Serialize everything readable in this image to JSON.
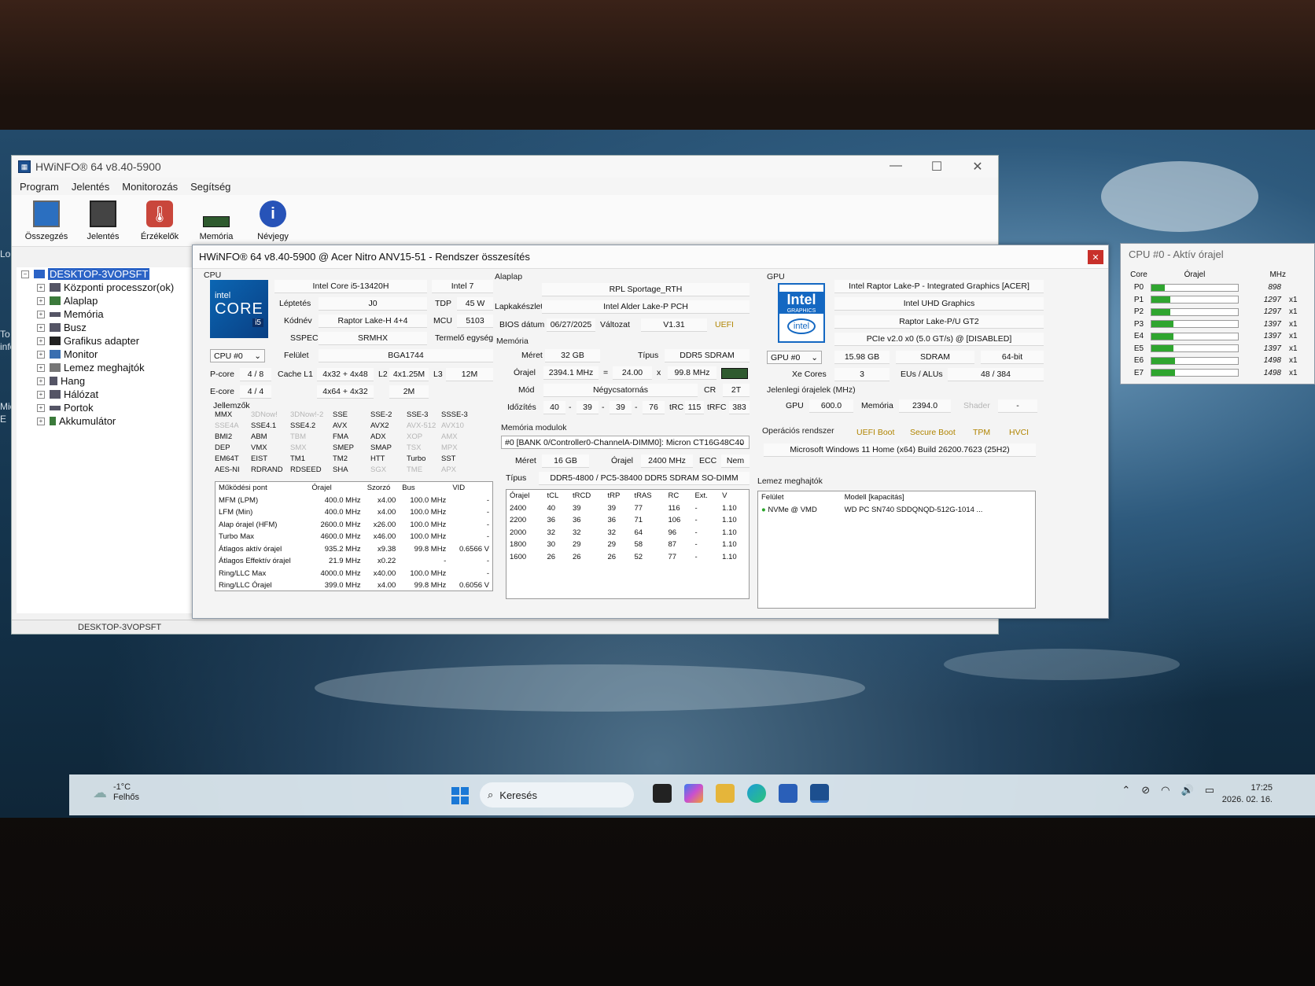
{
  "main_window": {
    "title": "HWiNFO® 64 v8.40-5900",
    "menu": [
      "Program",
      "Jelentés",
      "Monitorozás",
      "Segítség"
    ],
    "toolbar": [
      {
        "label": "Összegzés",
        "icon": "monitor-icon"
      },
      {
        "label": "Jelentés",
        "icon": "floppy-disk-icon"
      },
      {
        "label": "Érzékelők",
        "icon": "thermometer-icon"
      },
      {
        "label": "Memória",
        "icon": "ram-module-icon"
      },
      {
        "label": "Névjegy",
        "icon": "info-icon"
      }
    ],
    "tree": [
      {
        "label": "DESKTOP-3VOPSFT",
        "depth": 0,
        "selected": true
      },
      {
        "label": "Központi processzor(ok)",
        "depth": 1
      },
      {
        "label": "Alaplap",
        "depth": 1
      },
      {
        "label": "Memória",
        "depth": 1
      },
      {
        "label": "Busz",
        "depth": 1
      },
      {
        "label": "Grafikus adapter",
        "depth": 1
      },
      {
        "label": "Monitor",
        "depth": 1
      },
      {
        "label": "Lemez meghajtók",
        "depth": 1
      },
      {
        "label": "Hang",
        "depth": 1
      },
      {
        "label": "Hálózat",
        "depth": 1
      },
      {
        "label": "Portok",
        "depth": 1
      },
      {
        "label": "Akkumulátor",
        "depth": 1
      }
    ],
    "status": "DESKTOP-3VOPSFT"
  },
  "summary": {
    "title": "HWiNFO® 64 v8.40-5900 @ Acer Nitro ANV15-51 - Rendszer összesítés",
    "cpu": {
      "group": "CPU",
      "logo_top": "intel",
      "logo_mid": "CORE",
      "logo_badge": "i5",
      "name": "Intel Core i5-13420H",
      "brand": "Intel 7",
      "step_label": "Léptetés",
      "step": "J0",
      "tdp_label": "TDP",
      "tdp": "45 W",
      "code_label": "Kódnév",
      "code": "Raptor Lake-H 4+4",
      "mcu_label": "MCU",
      "mcu": "5103",
      "sspec_label": "SSPEC",
      "sspec": "SRMHX",
      "prod": "Termelő egység",
      "select": "CPU #0",
      "surface_label": "Felület",
      "surface": "BGA1744",
      "pcore_label": "P-core",
      "pcore": "4 / 8",
      "cache_label": "Cache L1",
      "l1p": "4x32 + 4x48",
      "l2_label": "L2",
      "l2p": "4x1.25M",
      "l3_label": "L3",
      "l3": "12M",
      "ecore_label": "E-core",
      "ecore": "4 / 4",
      "l1e": "4x64 + 4x32",
      "l2e": "2M",
      "features_label": "Jellemzők",
      "features": [
        [
          "MMX",
          "3DNow!",
          "3DNow!-2",
          "SSE",
          "SSE-2",
          "SSE-3",
          "SSSE-3"
        ],
        [
          "SSE4A",
          "SSE4.1",
          "SSE4.2",
          "AVX",
          "AVX2",
          "AVX-512",
          "AVX10"
        ],
        [
          "BMI2",
          "ABM",
          "TBM",
          "FMA",
          "ADX",
          "XOP",
          "AMX"
        ],
        [
          "DEP",
          "VMX",
          "SMX",
          "SMEP",
          "SMAP",
          "TSX",
          "MPX"
        ],
        [
          "EM64T",
          "EIST",
          "TM1",
          "TM2",
          "HTT",
          "Turbo",
          "SST"
        ],
        [
          "AES-NI",
          "RDRAND",
          "RDSEED",
          "SHA",
          "SGX",
          "TME",
          "APX"
        ]
      ],
      "features_dim": [
        [
          false,
          true,
          true,
          false,
          false,
          false,
          false
        ],
        [
          true,
          false,
          false,
          false,
          false,
          true,
          true
        ],
        [
          false,
          false,
          true,
          false,
          false,
          true,
          true
        ],
        [
          false,
          false,
          true,
          false,
          false,
          true,
          true
        ],
        [
          false,
          false,
          false,
          false,
          false,
          false,
          false
        ],
        [
          false,
          false,
          false,
          false,
          true,
          true,
          true
        ]
      ],
      "op_headers": [
        "Működési pont",
        "Órajel",
        "Szorzó",
        "Bus",
        "VID"
      ],
      "op_rows": [
        [
          "MFM (LPM)",
          "400.0 MHz",
          "x4.00",
          "100.0 MHz",
          "-"
        ],
        [
          "LFM (Min)",
          "400.0 MHz",
          "x4.00",
          "100.0 MHz",
          "-"
        ],
        [
          "Alap órajel (HFM)",
          "2600.0 MHz",
          "x26.00",
          "100.0 MHz",
          "-"
        ],
        [
          "Turbo Max",
          "4600.0 MHz",
          "x46.00",
          "100.0 MHz",
          "-"
        ],
        [
          "Átlagos aktív órajel",
          "935.2 MHz",
          "x9.38",
          "99.8 MHz",
          "0.6566 V"
        ],
        [
          "Átlagos Effektív órajel",
          "21.9 MHz",
          "x0.22",
          "-",
          "-"
        ],
        [
          "Ring/LLC Max",
          "4000.0 MHz",
          "x40.00",
          "100.0 MHz",
          "-"
        ],
        [
          "Ring/LLC Órajel",
          "399.0 MHz",
          "x4.00",
          "99.8 MHz",
          "0.6056 V"
        ]
      ]
    },
    "board": {
      "group": "Alaplap",
      "name": "RPL Sportage_RTH",
      "chipset_label": "Lapkakészlet",
      "chipset": "Intel Alder Lake-P PCH",
      "bios_label": "BIOS dátum",
      "bios_date": "06/27/2025",
      "ver_label": "Változat",
      "ver": "V1.31",
      "uefi": "UEFI"
    },
    "memory": {
      "group": "Memória",
      "size_label": "Méret",
      "size": "32 GB",
      "type_label": "Típus",
      "type": "DDR5 SDRAM",
      "clock_label": "Órajel",
      "clock": "2394.1 MHz",
      "eq": "=",
      "mult": "24.00",
      "x": "x",
      "bus": "99.8 MHz",
      "mode_label": "Mód",
      "mode": "Négycsatornás",
      "cr_label": "CR",
      "cr": "2T",
      "timing_label": "Időzítés",
      "timings": [
        "40",
        "39",
        "39",
        "76"
      ],
      "trc_label": "tRC",
      "trc": "115",
      "trfc_label": "tRFC",
      "trfc": "383",
      "modules_label": "Memória modulok",
      "module_select": "#0 [BANK 0/Controller0-ChannelA-DIMM0]: Micron CT16G48C40",
      "m_size_label": "Méret",
      "m_size": "16 GB",
      "m_clock_label": "Órajel",
      "m_clock": "2400 MHz",
      "ecc_label": "ECC",
      "ecc": "Nem",
      "m_type_label": "Típus",
      "m_type": "DDR5-4800 / PC5-38400 DDR5 SDRAM SO-DIMM",
      "t_headers": [
        "Órajel",
        "tCL",
        "tRCD",
        "tRP",
        "tRAS",
        "RC",
        "Ext.",
        "V"
      ],
      "t_rows": [
        [
          "2400",
          "40",
          "39",
          "39",
          "77",
          "116",
          "-",
          "1.10"
        ],
        [
          "2200",
          "36",
          "36",
          "36",
          "71",
          "106",
          "-",
          "1.10"
        ],
        [
          "2000",
          "32",
          "32",
          "32",
          "64",
          "96",
          "-",
          "1.10"
        ],
        [
          "1800",
          "30",
          "29",
          "29",
          "58",
          "87",
          "-",
          "1.10"
        ],
        [
          "1600",
          "26",
          "26",
          "26",
          "52",
          "77",
          "-",
          "1.10"
        ]
      ]
    },
    "gpu": {
      "group": "GPU",
      "logo_top": "Intel",
      "logo_sub": "GRAPHICS",
      "logo_ring": "intel",
      "name": "Intel Raptor Lake-P - Integrated Graphics [ACER]",
      "model": "Intel UHD Graphics",
      "chip": "Raptor Lake-P/U GT2",
      "pcie": "PCIe v2.0 x0 (5.0 GT/s) @ [DISABLED]",
      "select": "GPU #0",
      "vram": "15.98 GB",
      "vtype": "SDRAM",
      "bus": "64-bit",
      "xe_label": "Xe Cores",
      "xe": "3",
      "eu_label": "EUs / ALUs",
      "eu": "48 / 384",
      "clocks_label": "Jelenlegi órajelek (MHz)",
      "gpu_clk_label": "GPU",
      "gpu_clk": "600.0",
      "mem_clk_label": "Memória",
      "mem_clk": "2394.0",
      "shader_label": "Shader",
      "shader": "-"
    },
    "os": {
      "label": "Operációs rendszer",
      "flags": [
        "UEFI Boot",
        "Secure Boot",
        "TPM",
        "HVCI"
      ],
      "name": "Microsoft Windows 11 Home (x64) Build 26200.7623 (25H2)"
    },
    "disks": {
      "label": "Lemez meghajtók",
      "headers": [
        "Felület",
        "Modell [kapacitás]"
      ],
      "rows": [
        [
          "NVMe @ VMD",
          "WD PC SN740 SDDQNQD-512G-1014 ..."
        ]
      ]
    }
  },
  "cpu_clock": {
    "title": "CPU #0 - Aktív órajel",
    "headers": [
      "Core",
      "Órajel",
      "MHz"
    ],
    "rows": [
      {
        "core": "P0",
        "mhz": "898",
        "x": "",
        "fill": 0.15
      },
      {
        "core": "P1",
        "mhz": "1297",
        "x": "x1",
        "fill": 0.22
      },
      {
        "core": "P2",
        "mhz": "1297",
        "x": "x1",
        "fill": 0.22
      },
      {
        "core": "P3",
        "mhz": "1397",
        "x": "x1",
        "fill": 0.25
      },
      {
        "core": "E4",
        "mhz": "1397",
        "x": "x1",
        "fill": 0.25
      },
      {
        "core": "E5",
        "mhz": "1397",
        "x": "x1",
        "fill": 0.25
      },
      {
        "core": "E6",
        "mhz": "1498",
        "x": "x1",
        "fill": 0.27
      },
      {
        "core": "E7",
        "mhz": "1498",
        "x": "x1",
        "fill": 0.27
      }
    ]
  },
  "desktop_left": [
    "Lo",
    "To",
    "infor",
    "Mic",
    "E"
  ],
  "taskbar": {
    "weather_temp": "-1°C",
    "weather_desc": "Felhős",
    "search": "Keresés",
    "time": "17:25",
    "date": "2026. 02. 16."
  }
}
